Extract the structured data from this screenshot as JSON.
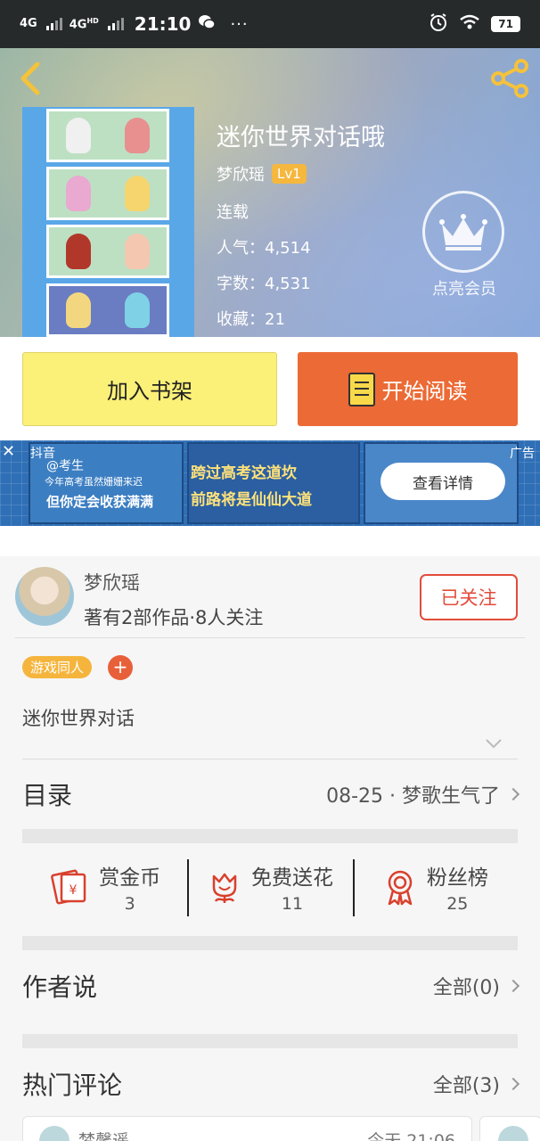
{
  "status_bar": {
    "network1": "4G",
    "network2": "4G",
    "network2_sup": "HD",
    "time": "21:10",
    "more": "···",
    "battery": "71"
  },
  "book": {
    "title": "迷你世界对话哦",
    "author": "梦欣瑶",
    "level": "Lv1",
    "status": "连载",
    "popularity_label": "人气：",
    "popularity": "4,514",
    "words_label": "字数：",
    "words": "4,531",
    "favorites_label": "收藏：",
    "favorites": "21"
  },
  "vip": {
    "label": "点亮会员"
  },
  "actions": {
    "add_shelf": "加入书架",
    "start_read": "开始阅读"
  },
  "ad": {
    "source": "抖音",
    "tag": "广告",
    "line1": "@考生",
    "line2": "今年高考虽然姗姗来迟",
    "line3": "但你定会收获满满",
    "slogan1": "跨过高考这道坎",
    "slogan2": "前路将是仙仙大道",
    "cta": "查看详情"
  },
  "author_card": {
    "name": "梦欣瑶",
    "stats": "著有2部作品·8人关注",
    "follow": "已关注",
    "tag": "游戏同人",
    "tag_add": "+",
    "intro": "迷你世界对话"
  },
  "catalog": {
    "title": "目录",
    "latest": "08-25 · 梦歌生气了"
  },
  "stats": [
    {
      "label": "赏金币",
      "value": "3",
      "icon": "red-envelope-icon"
    },
    {
      "label": "免费送花",
      "value": "11",
      "icon": "flower-icon"
    },
    {
      "label": "粉丝榜",
      "value": "25",
      "icon": "ribbon-medal-icon"
    }
  ],
  "author_says": {
    "title": "作者说",
    "all": "全部(0)"
  },
  "hot_comments": {
    "title": "热门评论",
    "all": "全部(3)"
  },
  "comment_preview": {
    "name": "梦馨遥",
    "time": "今天 21:06"
  },
  "colors": {
    "accent_orange": "#ec6a35",
    "shelf_yellow": "#fbf078",
    "follow_red": "#e24c3b",
    "tag_orange": "#f5b53d"
  }
}
